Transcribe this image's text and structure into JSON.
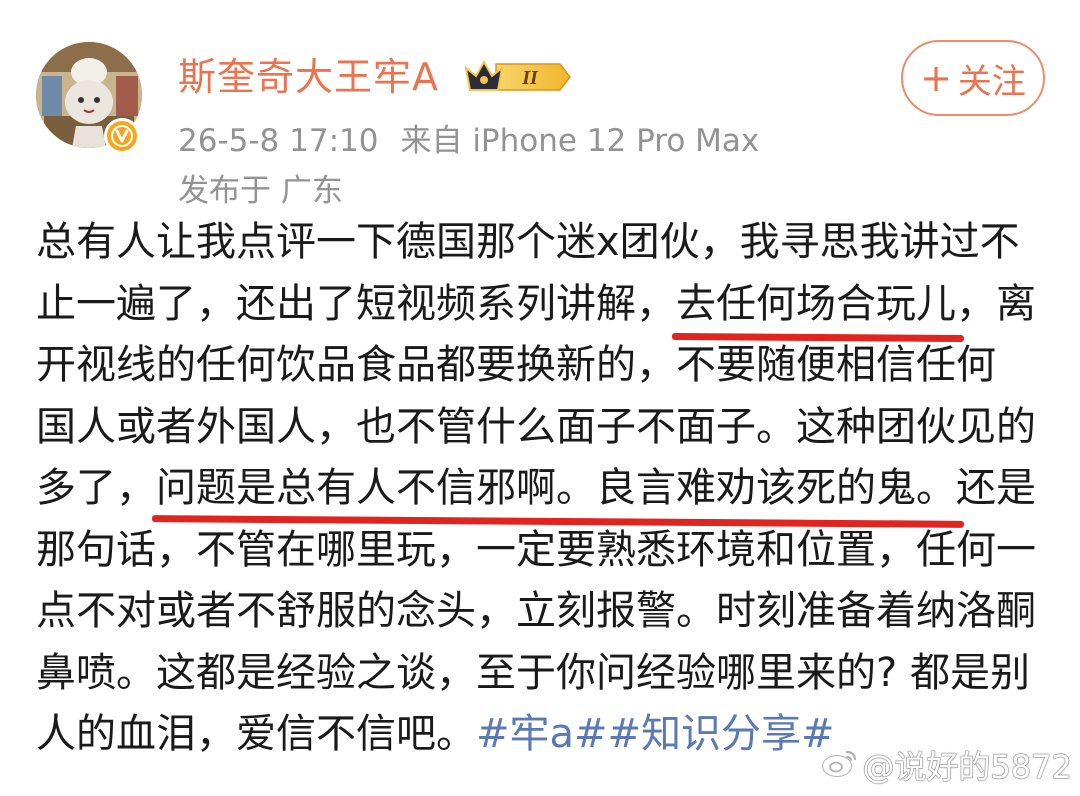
{
  "header": {
    "username": "斯奎奇大王牢A",
    "vip_level": "II",
    "date": "26-5-8 17:10",
    "source": "来自 iPhone 12 Pro Max",
    "location": "发布于 广东",
    "follow_label": "关注",
    "follow_plus": "+"
  },
  "post": {
    "lines": [
      [
        "总有人让我点评一下德国那个迷x团伙，我寻思我讲过不"
      ],
      [
        "止一遍了，还出了短视频系列讲解，",
        "去任何场合玩儿",
        "，离"
      ],
      [
        "开视线的任何饮品食品都要换新的，不要随便相信任何"
      ],
      [
        "国人或者外国人，也不管什么面子不面子。这种团伙见的"
      ],
      [
        "多了，",
        "问题是总有人不信邪啊。良言难劝该死的鬼。",
        "还是"
      ],
      [
        "那句话，不管在哪里玩，一定要熟悉环境和位置，任何一"
      ],
      [
        "点不对或者不舒服的念头，立刻报警。时刻准备着纳洛酮"
      ],
      [
        "鼻喷。这都是经验之谈，至于你问经验哪里来的? 都是别"
      ],
      [
        "人的血泪，爱信不信吧。"
      ]
    ],
    "hashtags": [
      "#牢a#",
      "#知识分享#"
    ]
  },
  "watermark": {
    "text": "@说好的5872"
  },
  "colors": {
    "username": "#eb7350",
    "meta": "#939393",
    "hashtag": "#5b79b3",
    "underline": "#e02420",
    "verified": "#f7a51c"
  },
  "icons": [
    "avatar-illustration",
    "verified-v-icon",
    "vip-crown-icon",
    "weibo-logo-icon"
  ]
}
